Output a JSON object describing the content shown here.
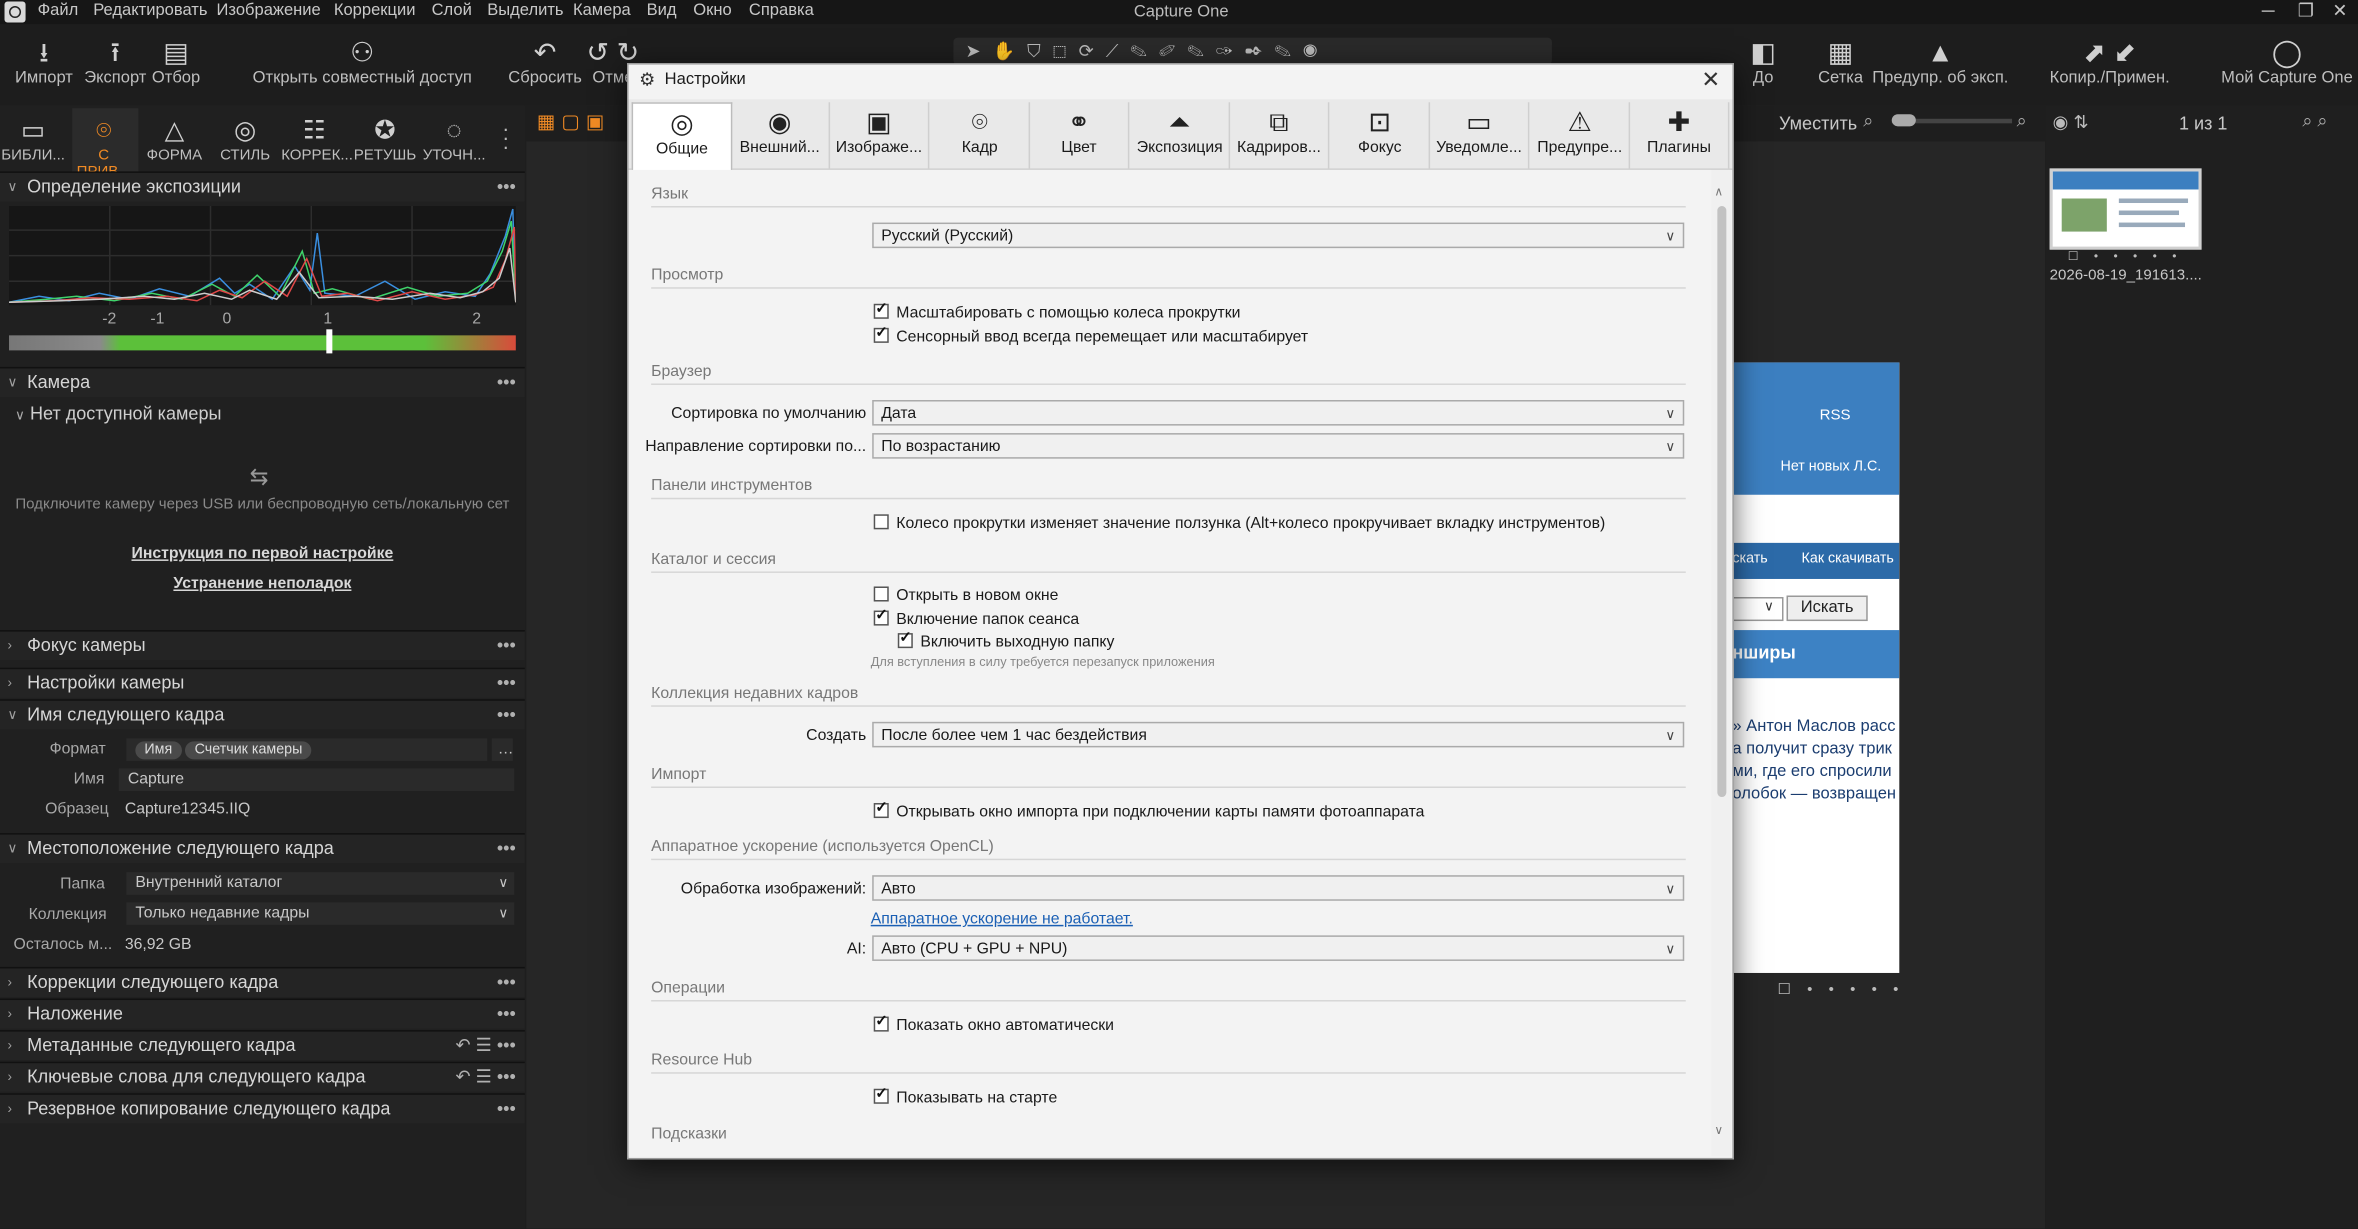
{
  "menubar": {
    "items": [
      "Файл",
      "Редактировать",
      "Изображение",
      "Коррекции",
      "Слой",
      "Выделить",
      "Камера",
      "Вид",
      "Окно",
      "Справка"
    ],
    "app_title": "Capture One"
  },
  "toolbar": {
    "import": "Импорт",
    "export": "Экспорт",
    "select": "Отбор",
    "share": "Открыть совместный доступ",
    "reset": "Сбросить",
    "undo": "Отме",
    "before": "До",
    "grid": "Сетка",
    "exposure_warning": "Предупр. об эксп.",
    "copy_apply": "Копир./Примен.",
    "my_capture_one": "Мой Capture One"
  },
  "tool_tabs": [
    {
      "label": "БИБЛИ...",
      "icon": "library-icon"
    },
    {
      "label": "С ПРИВ...",
      "icon": "camera-capture-icon"
    },
    {
      "label": "ФОРМА",
      "icon": "lens-icon"
    },
    {
      "label": "СТИЛЬ",
      "icon": "style-icon"
    },
    {
      "label": "КОРРЕК...",
      "icon": "sliders-icon"
    },
    {
      "label": "РЕТУШЬ",
      "icon": "retouch-icon"
    },
    {
      "label": "УТОЧН...",
      "icon": "refine-icon"
    }
  ],
  "left_panel": {
    "exposure_title": "Определение экспозиции",
    "histogram_ticks": [
      "-2",
      "-1",
      "0",
      "1",
      "2"
    ],
    "camera_title": "Камера",
    "no_camera": "Нет доступной камеры",
    "connect_hint": "Подключите камеру через USB или беспроводную сеть/локальную сет",
    "first_setup_link": "Инструкция по первой настройке",
    "troubleshoot_link": "Устранение неполадок",
    "focus_title": "Фокус камеры",
    "camera_settings_title": "Настройки камеры",
    "next_name_title": "Имя следующего кадра",
    "format_label": "Формат",
    "format_tokens": [
      "Имя",
      "Счетчик камеры"
    ],
    "name_label": "Имя",
    "name_value": "Capture",
    "sample_label": "Образец",
    "sample_value": "Capture12345.IIQ",
    "location_title": "Местоположение следующего кадра",
    "folder_label": "Папка",
    "folder_value": "Внутренний каталог",
    "collection_label": "Коллекция",
    "collection_value": "Только недавние кадры",
    "remaining_label": "Осталось м...",
    "remaining_value": "36,92 GB",
    "adjustments_title": "Коррекции следующего кадра",
    "overlay_title": "Наложение",
    "metadata_title": "Метаданные следующего кадра",
    "keywords_title": "Ключевые слова для следующего кадра",
    "backup_title": "Резервное копирование следующего кадра"
  },
  "viewer": {
    "fit_label": "Уместить",
    "count": "1 из 1",
    "web_rss": "RSS",
    "web_no_new": "Нет новых Л.С.",
    "web_nav1": "скать",
    "web_nav2": "Как скачивать",
    "web_search_btn": "Искать",
    "web_heading": "нширы",
    "web_text": [
      "» Антон Маслов расс",
      "а получит сразу трик",
      "ми, где его спросили",
      "олобок — возвращен"
    ]
  },
  "browser": {
    "thumb_name": "2026-08-19_191613...."
  },
  "dialog": {
    "title": "Настройки",
    "tabs": [
      {
        "label": "Общие",
        "icon": "general-icon"
      },
      {
        "label": "Внешний...",
        "icon": "eye-icon"
      },
      {
        "label": "Изображе...",
        "icon": "image-icon"
      },
      {
        "label": "Кадр",
        "icon": "capture-icon"
      },
      {
        "label": "Цвет",
        "icon": "color-icon"
      },
      {
        "label": "Экспозиция",
        "icon": "exposure-icon"
      },
      {
        "label": "Кадриров...",
        "icon": "crop-icon"
      },
      {
        "label": "Фокус",
        "icon": "focus-icon"
      },
      {
        "label": "Уведомле...",
        "icon": "notification-icon"
      },
      {
        "label": "Предупре...",
        "icon": "warning-icon"
      },
      {
        "label": "Плагины",
        "icon": "plugin-icon"
      }
    ],
    "groups": {
      "language": "Язык",
      "view": "Просмотр",
      "browser": "Браузер",
      "toolbars": "Панели инструментов",
      "catalog": "Каталог и сессия",
      "recent": "Коллекция недавних кадров",
      "import": "Импорт",
      "hardware": "Аппаратное ускорение (используется OpenCL)",
      "operations": "Операции",
      "resource_hub": "Resource Hub",
      "hints": "Подсказки"
    },
    "language_value": "Русский (Русский)",
    "cb_zoom_wheel": "Масштабировать с помощью колеса прокрутки",
    "cb_touch": "Сенсорный ввод всегда перемещает или масштабирует",
    "sort_default_label": "Сортировка по умолчанию",
    "sort_default_value": "Дата",
    "sort_dir_label": "Направление сортировки по...",
    "sort_dir_value": "По возрастанию",
    "cb_scroll_slider": "Колесо прокрутки изменяет значение ползунка (Alt+колесо прокручивает вкладку инструментов)",
    "cb_new_window": "Открыть в новом окне",
    "cb_session_folders": "Включение папок сеанса",
    "cb_output_folder": "Включить выходную папку",
    "restart_note": "Для вступления в силу требуется перезапуск приложения",
    "create_label": "Создать",
    "create_value": "После более чем 1 час бездействия",
    "cb_import_window": "Открывать окно импорта при подключении карты памяти фотоаппарата",
    "processing_label": "Обработка изображений:",
    "processing_value": "Авто",
    "hw_link": "Аппаратное ускорение не работает.",
    "ai_label": "AI:",
    "ai_value": "Авто (CPU + GPU + NPU)",
    "cb_show_auto": "Показать окно автоматически",
    "cb_show_start": "Показывать на старте"
  },
  "colors": {
    "accent_orange": "#f08a24",
    "link_blue": "#1a5fb4"
  }
}
